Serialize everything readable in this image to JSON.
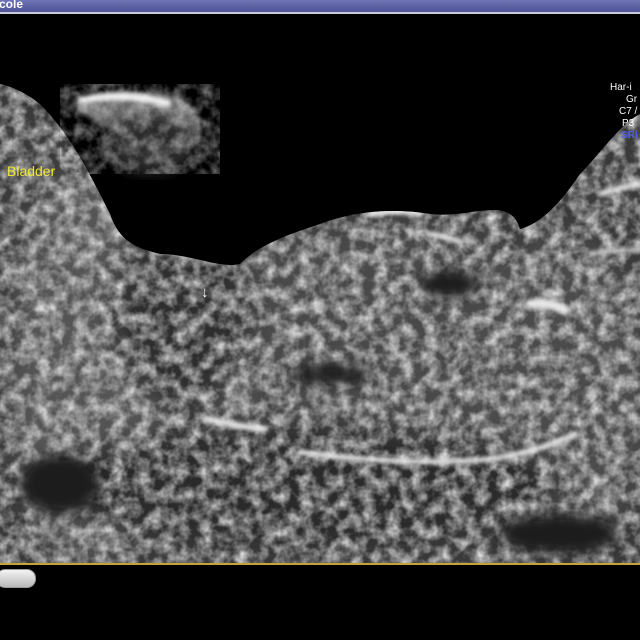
{
  "window": {
    "title": "cole"
  },
  "annotations": {
    "organ_label": "Bladder",
    "arrow_glyph": "↓"
  },
  "info_panel": {
    "lines": [
      "Har-i",
      "Gr",
      "C7 /",
      "P3",
      "SRI"
    ]
  },
  "colors": {
    "titlebar": "#5a5fa4",
    "label_text": "#f0ea2a",
    "sri_text": "#4e5cf0",
    "rule": "#c9a13a"
  }
}
